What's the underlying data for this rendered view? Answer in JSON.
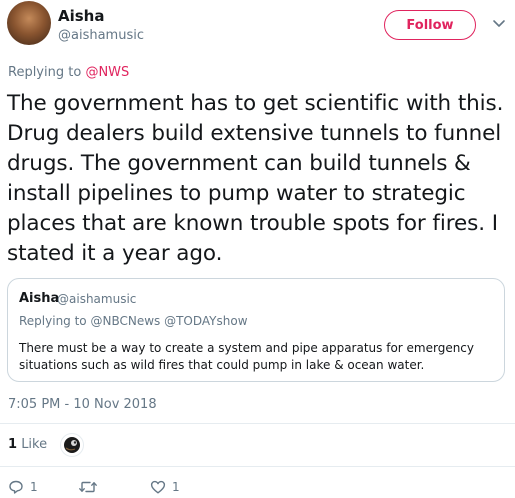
{
  "author": {
    "name": "Aisha",
    "handle": "@aishamusic"
  },
  "follow_label": "Follow",
  "replying_to": {
    "prefix": "Replying to",
    "users": "@NWS"
  },
  "tweet_text": "The government has to get scientific with this. Drug dealers build extensive tunnels to funnel drugs. The government can build tunnels & install pipelines to pump water to strategic places that are known trouble spots for fires. I stated it a year ago.",
  "quoted_tweet": {
    "name": "Aisha",
    "handle": "@aishamusic",
    "replying_prefix": "Replying to",
    "replying_users": "@NBCNews @TODAYshow",
    "text": "There must be a way to create a system and pipe apparatus for emergency situations such as wild fires that could pump in lake & ocean water."
  },
  "timestamp": "7:05 PM - 10 Nov 2018",
  "likes": {
    "count": "1",
    "label": "Like"
  },
  "actions": {
    "reply_count": "1",
    "retweet_count": "",
    "like_count": "1"
  },
  "colors": {
    "accent": "#e0245e",
    "secondary_text": "#657786",
    "border": "#ccd6dd"
  }
}
